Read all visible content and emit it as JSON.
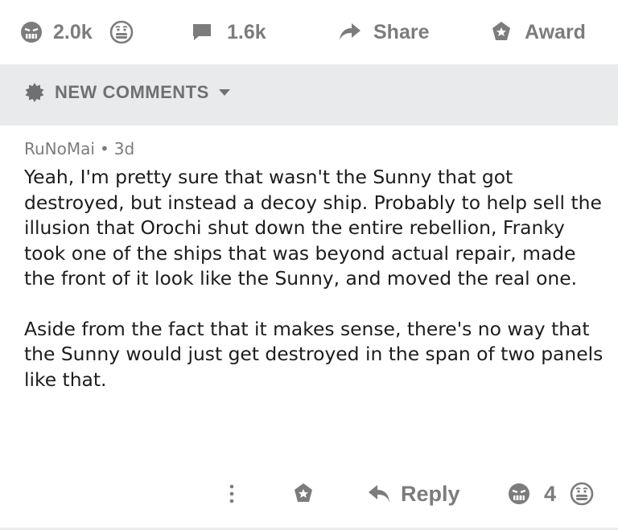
{
  "post_actions": {
    "upvote_icon": "angry-face-upvote-icon",
    "vote_count": "2.0k",
    "downvote_icon": "scared-face-downvote-icon",
    "comments_icon": "comment-bubble-icon",
    "comments_count": "1.6k",
    "share_icon": "share-arrow-icon",
    "share_label": "Share",
    "award_icon": "award-star-icon",
    "award_label": "Award"
  },
  "new_comments": {
    "icon": "gear-burst-icon",
    "label": "NEW COMMENTS",
    "caret_icon": "caret-down-icon"
  },
  "comment": {
    "author": "RuNoMai",
    "separator": "•",
    "age": "3d",
    "paragraphs": [
      "Yeah, I'm pretty sure that wasn't the Sunny that got destroyed, but instead a decoy ship. Probably to help sell the illusion that Orochi shut down the entire rebellion, Franky took one of the ships that was beyond actual repair, made the front of it look like the Sunny, and moved the real one.",
      "Aside from the fact that it makes sense, there's no way that the Sunny would just get destroyed in the span of two panels like that."
    ],
    "actions": {
      "more_icon": "more-vertical-icon",
      "award_icon": "award-star-icon",
      "reply_icon": "reply-arrow-icon",
      "reply_label": "Reply",
      "vote_count": "4"
    }
  },
  "colors": {
    "muted_text": "#7c7c7c",
    "banner_bg": "#e9eaec",
    "body_text": "#1c1c1c"
  }
}
